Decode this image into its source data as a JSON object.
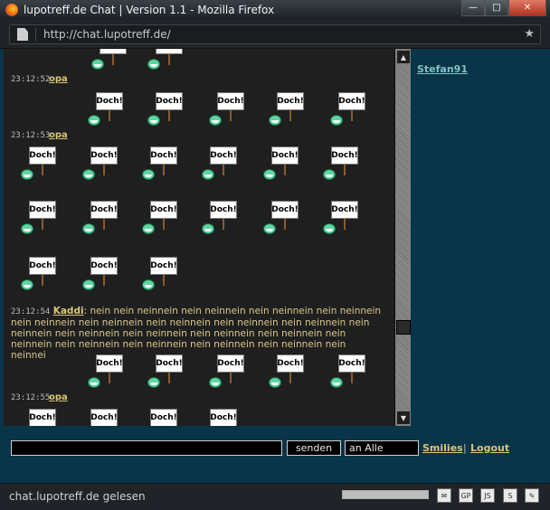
{
  "window": {
    "title": "lupotreff.de Chat | Version 1.1 - Mozilla Firefox",
    "minimize": "—",
    "maximize": "□",
    "close": "✕"
  },
  "urlbar": {
    "url": "http://chat.lupotreff.de/",
    "star": "★"
  },
  "smiley": {
    "sign_text": "Doch!"
  },
  "messages": [
    {
      "time": "23:12:52",
      "nick": "opa"
    },
    {
      "time": "23:12:53",
      "nick": "opa"
    },
    {
      "time": "23:12:54",
      "nick": "Kaddi",
      "text": ": nein nein neinnein nein neinnein nein neinnein nein neinnein nein neinnein nein neinnein nein neinnein nein neinnein nein neinnein nein neinnein nein neinnein nein neinnein nein neinnein nein neinnein nein neinnein nein neinnein nein neinnein nein neinnein nein neinnein nein neinnei"
    },
    {
      "time": "23:12:55",
      "nick": "opa"
    }
  ],
  "users": [
    "Stefan91"
  ],
  "input": {
    "value": "",
    "send_label": "senden",
    "target_label": "an Alle"
  },
  "links": {
    "smilies": "Smilies",
    "separator": "|",
    "logout": "Logout"
  },
  "statusbar": {
    "text": "chat.lupotreff.de gelesen"
  },
  "colors": {
    "chat_bg": "#1f1f1f",
    "page_bg": "#0a3448",
    "nick": "#d6c77a",
    "user": "#7fc3c3"
  }
}
